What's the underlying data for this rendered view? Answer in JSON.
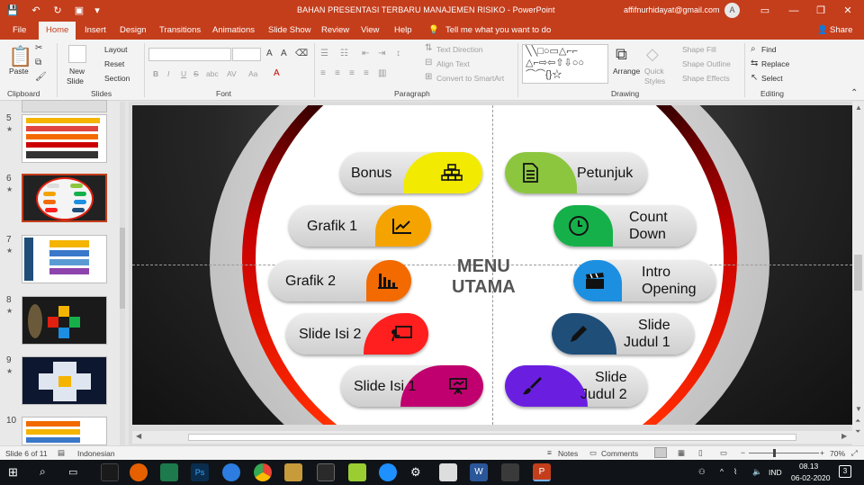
{
  "window": {
    "title": "BAHAN PRESENTASI TERBARU MANAJEMEN RISIKO  -  PowerPoint",
    "account": "affifnurhidayat@gmail.com",
    "avatar": "A",
    "accent": "#c43e1c"
  },
  "tabs": [
    "File",
    "Home",
    "Insert",
    "Design",
    "Transitions",
    "Animations",
    "Slide Show",
    "Review",
    "View",
    "Help"
  ],
  "active_tab": "Home",
  "tell_me": "Tell me what you want to do",
  "share": "Share",
  "ribbon": {
    "clipboard": {
      "group": "Clipboard",
      "paste": "Paste"
    },
    "slides": {
      "group": "Slides",
      "new_slide": "New",
      "new_slide2": "Slide",
      "layout": "Layout",
      "reset": "Reset",
      "section": "Section"
    },
    "font": {
      "group": "Font",
      "bold": "B",
      "italic": "I",
      "underline": "U",
      "strike": "S",
      "shadow": "abc",
      "spacing": "AV",
      "case": "Aa"
    },
    "paragraph": {
      "group": "Paragraph",
      "text_direction": "Text Direction",
      "align_text": "Align Text",
      "smartart": "Convert to SmartArt"
    },
    "drawing": {
      "group": "Drawing",
      "arrange": "Arrange",
      "quick_styles": "Quick",
      "quick_styles2": "Styles",
      "shape_fill": "Shape Fill",
      "shape_outline": "Shape Outline",
      "shape_effects": "Shape Effects"
    },
    "editing": {
      "group": "Editing",
      "find": "Find",
      "replace": "Replace",
      "select": "Select"
    }
  },
  "thumbnails": [
    {
      "num": "5",
      "star": "★"
    },
    {
      "num": "6",
      "star": "★"
    },
    {
      "num": "7",
      "star": "★"
    },
    {
      "num": "8",
      "star": "★"
    },
    {
      "num": "9",
      "star": "★"
    },
    {
      "num": "10",
      "star": ""
    }
  ],
  "slide": {
    "title_line1": "MENU",
    "title_line2": "UTAMA",
    "items": [
      {
        "label": "Bonus",
        "color": "#f2ea00",
        "icon": "gold-bars-icon"
      },
      {
        "label": "Grafik 1",
        "color": "#f5a300",
        "icon": "line-chart-icon"
      },
      {
        "label": "Grafik 2",
        "color": "#f26a00",
        "icon": "bar-chart-icon"
      },
      {
        "label": "Slide Isi 2",
        "color": "#ff1f1f",
        "icon": "presentation-icon"
      },
      {
        "label": "Slide Isi 1",
        "color": "#c0006e",
        "icon": "easel-icon"
      },
      {
        "label": "Petunjuk",
        "color": "#8cc63f",
        "icon": "document-icon"
      },
      {
        "label": "Count\nDown",
        "color": "#16b04a",
        "icon": "clock-icon"
      },
      {
        "label": "Intro\nOpening",
        "color": "#1c8fe0",
        "icon": "clapperboard-icon"
      },
      {
        "label": "Slide\nJudul 1",
        "color": "#1f4e79",
        "icon": "pencil-icon"
      },
      {
        "label": "Slide\nJudul 2",
        "color": "#6a1fe0",
        "icon": "brush-icon"
      }
    ]
  },
  "status": {
    "slide_of": "Slide 6 of 11",
    "language": "Indonesian",
    "notes": "Notes",
    "comments": "Comments",
    "zoom": "70%"
  },
  "taskbar": {
    "time": "08.13",
    "date": "06-02-2020",
    "lang": "IND",
    "notifications": "3"
  }
}
